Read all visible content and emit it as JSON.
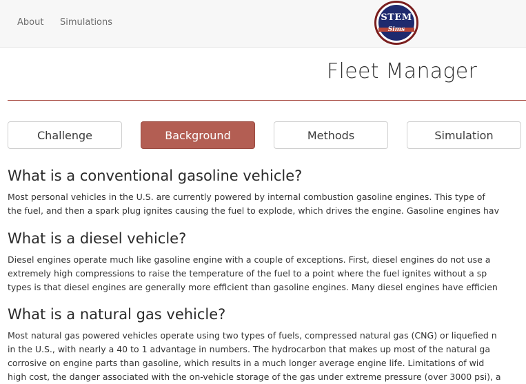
{
  "nav": {
    "about": "About",
    "simulations": "Simulations"
  },
  "logo": {
    "line1": "STEM",
    "line2": "Sims"
  },
  "page": {
    "title": "Fleet Manager"
  },
  "tabs": [
    {
      "label": "Challenge",
      "active": false
    },
    {
      "label": "Background",
      "active": true
    },
    {
      "label": "Methods",
      "active": false
    },
    {
      "label": "Simulation",
      "active": false
    }
  ],
  "sections": [
    {
      "heading": "What is a conventional gasoline vehicle?",
      "lines": [
        "Most personal vehicles in the U.S. are currently powered by internal combustion gasoline engines. This type of",
        "the fuel, and then a spark plug ignites causing the fuel to explode, which drives the engine. Gasoline engines hav"
      ]
    },
    {
      "heading": "What is a diesel vehicle?",
      "lines": [
        "Diesel engines operate much like gasoline engine with a couple of exceptions. First, diesel engines do not use a",
        "extremely high compressions to raise the temperature of the fuel to a point where the fuel ignites without a sp",
        "types is that diesel engines are generally more efficient than gasoline engines. Many diesel engines have efficien"
      ]
    },
    {
      "heading": "What is a natural gas vehicle?",
      "lines": [
        "Most natural gas powered vehicles operate using two types of fuels, compressed natural gas (CNG) or liquefied n",
        "in the U.S., with nearly a 40 to 1 advantage in numbers. The hydrocarbon that makes up most of the natural ga",
        "corrosive on engine parts than gasoline, which results in a much longer average engine life. Limitations of wid",
        "high cost, the danger associated with the on-vehicle storage of the gas under extreme pressure (over 3000 psi), a"
      ]
    }
  ],
  "colors": {
    "accent": "#b35e53",
    "rule": "#a4443b",
    "logo_blue": "#1e2a6e",
    "logo_ring": "#7a1e1e"
  }
}
